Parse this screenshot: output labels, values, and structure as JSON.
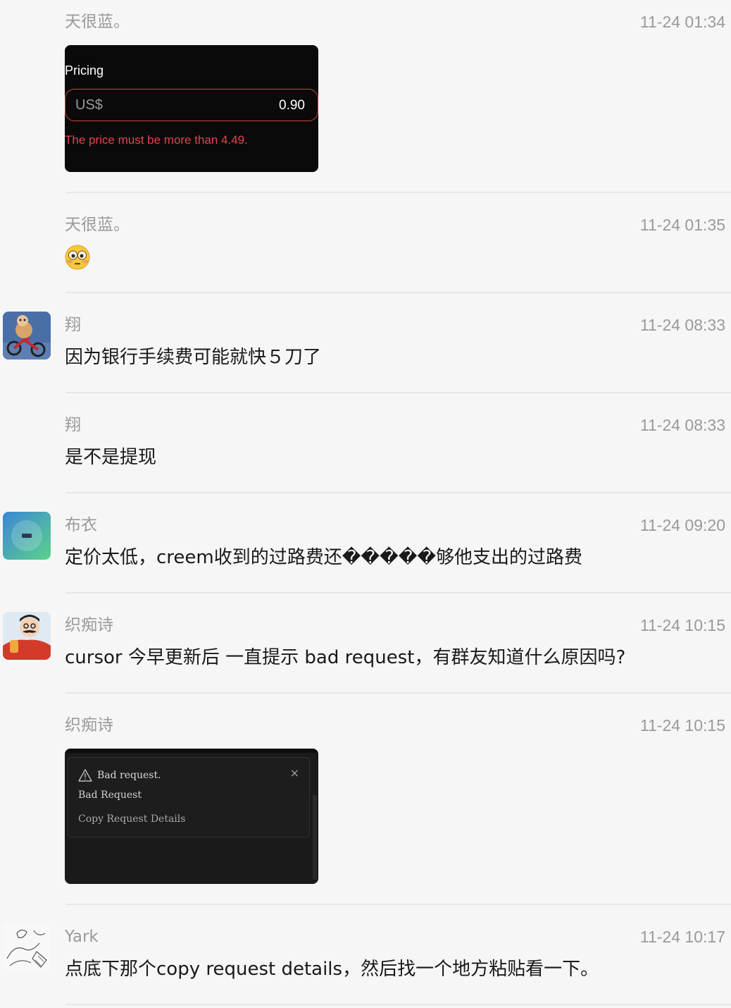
{
  "messages": [
    {
      "sender": "天很蓝。",
      "time": "11-24 01:34"
    },
    {
      "sender": "天很蓝。",
      "time": "11-24 01:35"
    },
    {
      "sender": "翔",
      "time": "11-24 08:33",
      "text": "因为银行手续费可能就快５刀了"
    },
    {
      "sender": "翔",
      "time": "11-24 08:33",
      "text": "是不是提现"
    },
    {
      "sender": "布衣",
      "time": "11-24 09:20",
      "text": "定价太低，creem收到的过路费还�����够他支出的过路费"
    },
    {
      "sender": "织痴诗",
      "time": "11-24 10:15",
      "text": "cursor 今早更新后 一直提示 bad request，有群友知道什么原因吗?"
    },
    {
      "sender": "织痴诗",
      "time": "11-24 10:15"
    },
    {
      "sender": "Yark",
      "time": "11-24 10:17",
      "text": "点底下那个copy request details，然后找一个地方粘贴看一下。"
    }
  ],
  "pricing_image": {
    "label": "Pricing",
    "currency": "US$",
    "value": "0.90",
    "error": "The price must be more than 4.49."
  },
  "badrequest_image": {
    "title": "Bad request.",
    "subtitle": "Bad Request",
    "copy_link": "Copy Request Details",
    "close": "×"
  },
  "emoji_icon": "flushed-face-icon"
}
